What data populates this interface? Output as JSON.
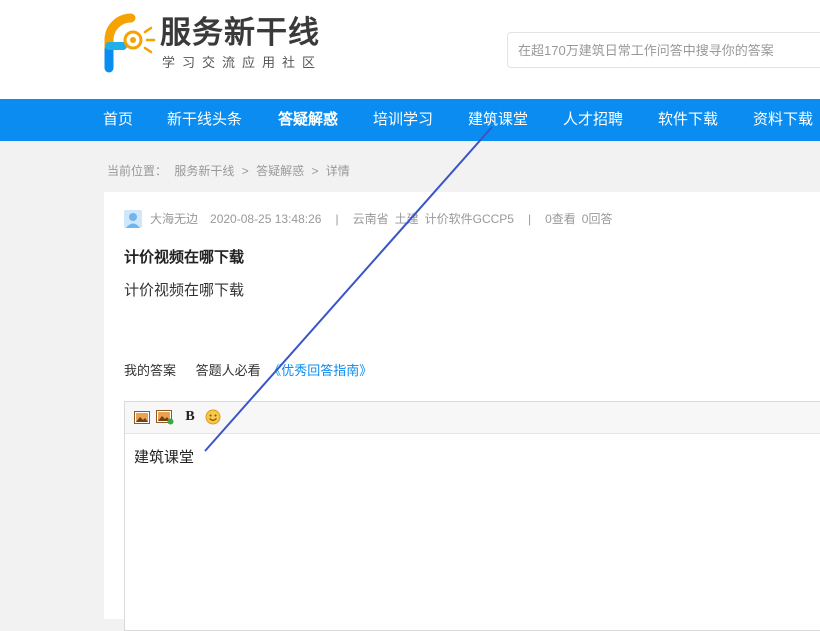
{
  "header": {
    "logo_title": "服务新干线",
    "logo_subtitle": "学习交流应用社区",
    "search_placeholder": "在超170万建筑日常工作问答中搜寻你的答案"
  },
  "nav": {
    "items": [
      {
        "label": "首页"
      },
      {
        "label": "新干线头条"
      },
      {
        "label": "答疑解惑"
      },
      {
        "label": "培训学习"
      },
      {
        "label": "建筑课堂"
      },
      {
        "label": "人才招聘"
      },
      {
        "label": "软件下载"
      },
      {
        "label": "资料下载"
      }
    ],
    "active_label": "答疑解惑"
  },
  "breadcrumb": {
    "prefix": "当前位置：",
    "items": [
      "服务新干线",
      "答疑解惑",
      "详情"
    ],
    "separator": ">"
  },
  "question": {
    "author": "大海无边",
    "datetime": "2020-08-25 13:48:26",
    "region": "云南省",
    "category": "土建",
    "software": "计价软件GCCP5",
    "views": "0查看",
    "answers": "0回答",
    "title": "计价视频在哪下载",
    "body": "计价视频在哪下载"
  },
  "answer": {
    "my_answer_label": "我的答案",
    "must_read_label": "答题人必看",
    "guide_link": "《优秀回答指南》",
    "editor_text": "建筑课堂",
    "toolbar": [
      "image-icon",
      "image-upload-icon",
      "bold-icon",
      "emoji-icon"
    ],
    "bold_label": "B"
  },
  "colors": {
    "nav_bg": "#0a8cf0",
    "link": "#0a8cf0",
    "annotation_line": "#3a55c8"
  }
}
